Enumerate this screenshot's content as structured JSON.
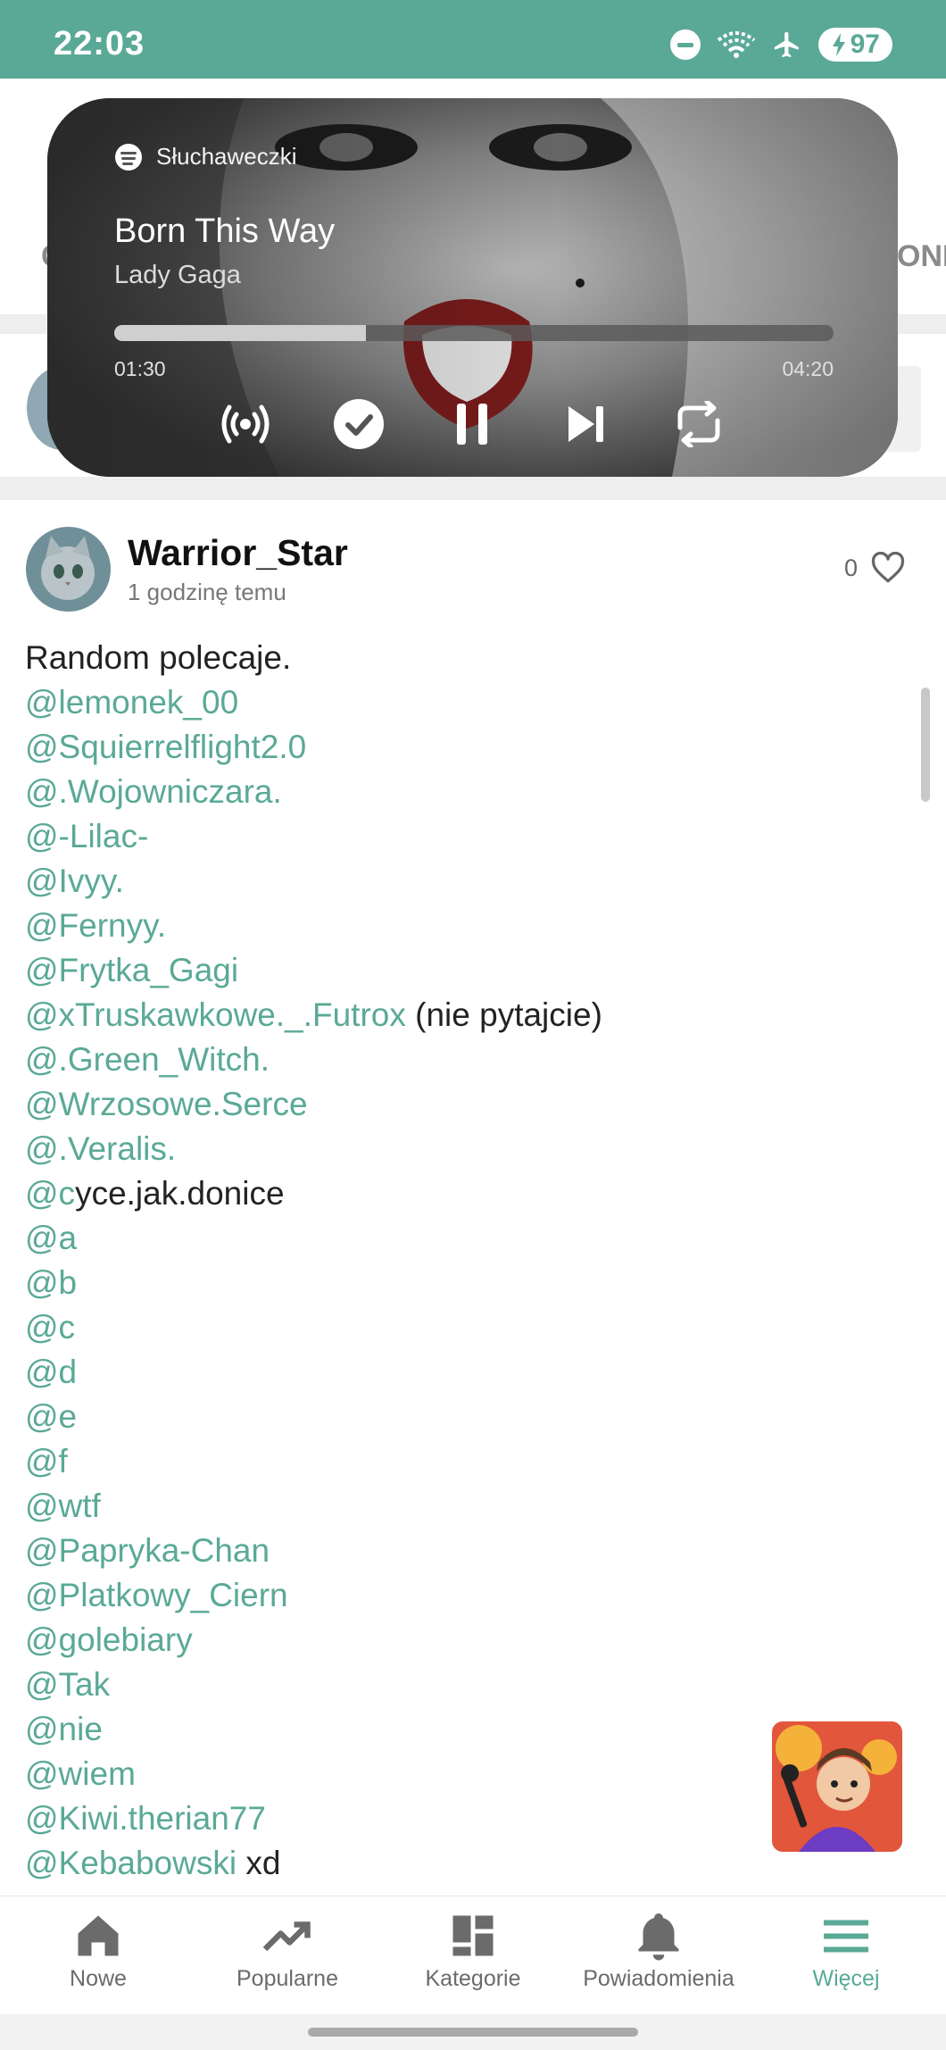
{
  "status_bar": {
    "time": "22:03",
    "battery": "97",
    "icons": [
      "do-not-disturb-icon",
      "wifi-icon",
      "airplane-icon",
      "battery-charging-icon"
    ],
    "background_color": "#5aa996"
  },
  "header_peek": {
    "right_text_fragment": "ONE"
  },
  "media_player": {
    "source": "Słuchaweczki",
    "title": "Born This Way",
    "artist": "Lady Gaga",
    "current_time": "01:30",
    "total_time": "04:20",
    "progress_fraction": 0.35,
    "controls": [
      "broadcast-icon",
      "saved-check-icon",
      "pause-icon",
      "skip-next-icon",
      "repeat-icon"
    ]
  },
  "post": {
    "author": "Warrior_Star",
    "time_ago": "1 godzinę temu",
    "likes": "0",
    "lines": [
      [
        {
          "t": "Random polecaje.",
          "m": false
        }
      ],
      [
        {
          "t": "@lemonek_00",
          "m": true
        }
      ],
      [
        {
          "t": "@Squierrelflight2.0",
          "m": true
        }
      ],
      [
        {
          "t": "@.Wojowniczara.",
          "m": true
        }
      ],
      [
        {
          "t": "@-Lilac-",
          "m": true
        }
      ],
      [
        {
          "t": "@Ivyy.",
          "m": true
        }
      ],
      [
        {
          "t": "@Fernyy.",
          "m": true
        }
      ],
      [
        {
          "t": "@Frytka_Gagi",
          "m": true
        }
      ],
      [
        {
          "t": "@xTruskawkowe._.Futrox",
          "m": true
        },
        {
          "t": " (nie pytajcie)",
          "m": false
        }
      ],
      [
        {
          "t": "@.Green_Witch.",
          "m": true
        }
      ],
      [
        {
          "t": "@Wrzosowe.Serce",
          "m": true
        }
      ],
      [
        {
          "t": "@.Veralis.",
          "m": true
        }
      ],
      [
        {
          "t": "@c",
          "m": true
        },
        {
          "t": "yce.jak.donice",
          "m": false
        }
      ],
      [
        {
          "t": "@a",
          "m": true
        }
      ],
      [
        {
          "t": "@b",
          "m": true
        }
      ],
      [
        {
          "t": "@c",
          "m": true
        }
      ],
      [
        {
          "t": "@d",
          "m": true
        }
      ],
      [
        {
          "t": "@e",
          "m": true
        }
      ],
      [
        {
          "t": "@f",
          "m": true
        }
      ],
      [
        {
          "t": "@wtf",
          "m": true
        }
      ],
      [
        {
          "t": "@Papryka-Chan",
          "m": true
        }
      ],
      [
        {
          "t": "@Platkowy_Ciern",
          "m": true
        }
      ],
      [
        {
          "t": "@golebiary",
          "m": true
        }
      ],
      [
        {
          "t": "@Tak",
          "m": true
        }
      ],
      [
        {
          "t": "@nie",
          "m": true
        }
      ],
      [
        {
          "t": "@wiem",
          "m": true
        }
      ],
      [
        {
          "t": "@Kiwi.therian77",
          "m": true
        }
      ],
      [
        {
          "t": "@Kebabowski",
          "m": true
        },
        {
          "t": " xd",
          "m": false
        }
      ]
    ]
  },
  "bottom_nav": {
    "items": [
      {
        "label": "Nowe",
        "icon": "home-icon",
        "active": false
      },
      {
        "label": "Popularne",
        "icon": "trending-icon",
        "active": false
      },
      {
        "label": "Kategorie",
        "icon": "grid-icon",
        "active": false
      },
      {
        "label": "Powiadomienia",
        "icon": "bell-icon",
        "active": false
      },
      {
        "label": "Więcej",
        "icon": "menu-icon",
        "active": true
      }
    ]
  },
  "colors": {
    "accent": "#5aa996",
    "mention": "#5aa996",
    "text": "#222222"
  }
}
